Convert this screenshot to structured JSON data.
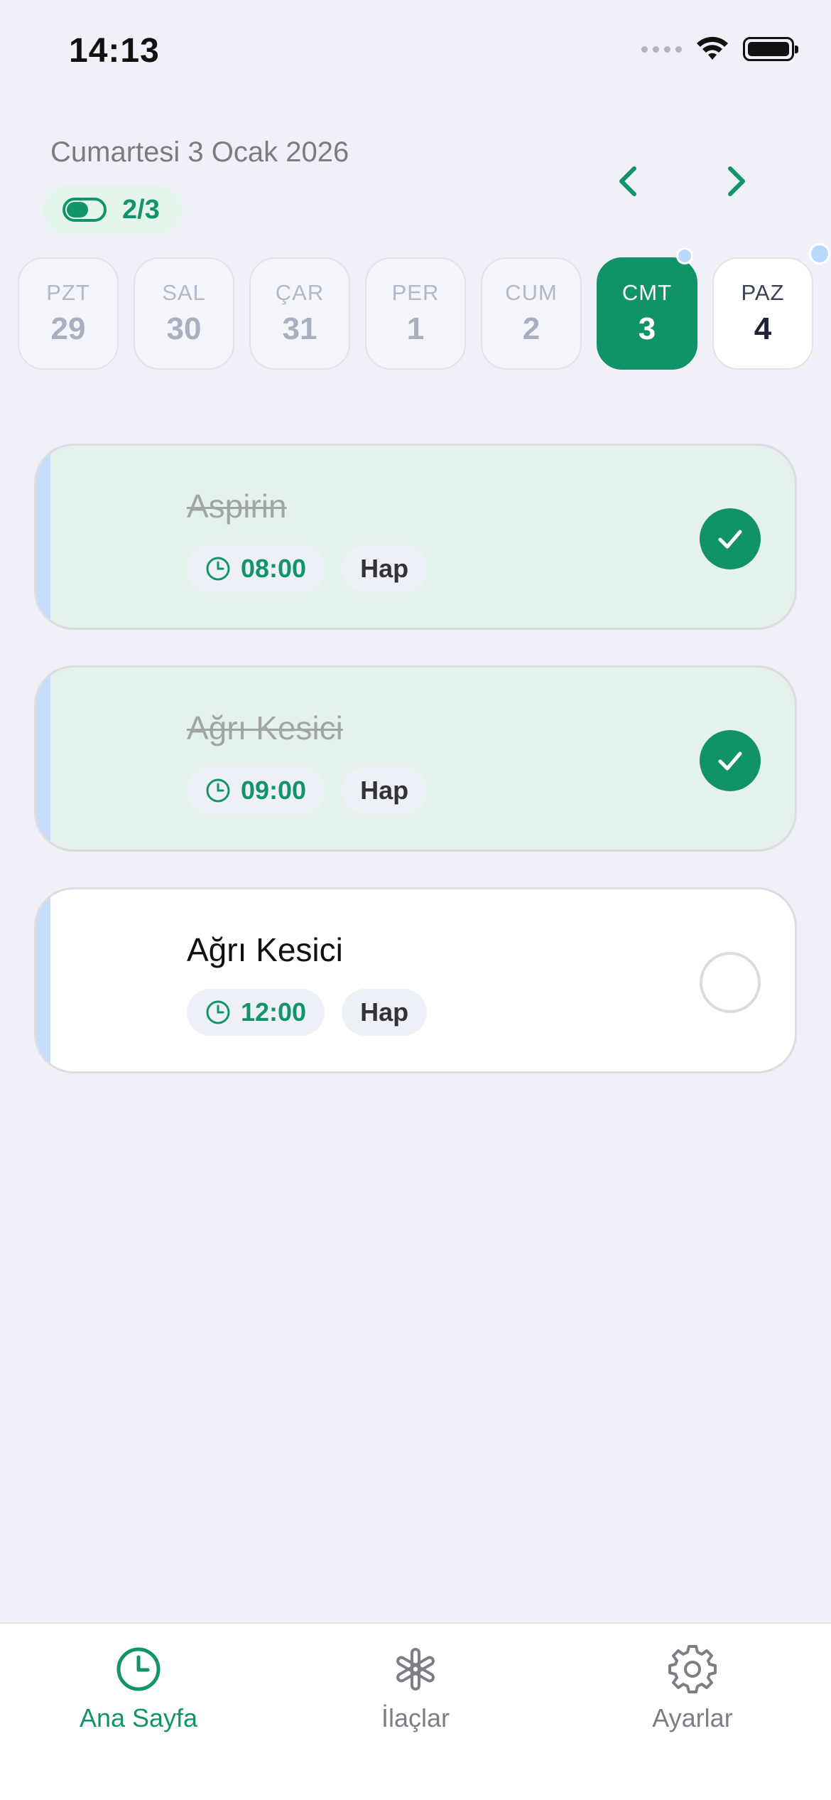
{
  "status_bar": {
    "time": "14:13"
  },
  "header": {
    "date": "Cumartesi 3 Ocak 2026",
    "progress": "2/3"
  },
  "week": [
    {
      "name": "PZT",
      "num": "29",
      "state": "past"
    },
    {
      "name": "SAL",
      "num": "30",
      "state": "past"
    },
    {
      "name": "ÇAR",
      "num": "31",
      "state": "past"
    },
    {
      "name": "PER",
      "num": "1",
      "state": "past"
    },
    {
      "name": "CUM",
      "num": "2",
      "state": "past"
    },
    {
      "name": "CMT",
      "num": "3",
      "state": "selected"
    },
    {
      "name": "PAZ",
      "num": "4",
      "state": "future"
    }
  ],
  "doses": [
    {
      "name": "Aspirin",
      "time": "08:00",
      "type": "Hap",
      "taken": true
    },
    {
      "name": "Ağrı Kesici",
      "time": "09:00",
      "type": "Hap",
      "taken": true
    },
    {
      "name": "Ağrı Kesici",
      "time": "12:00",
      "type": "Hap",
      "taken": false
    }
  ],
  "tabs": [
    {
      "label": "Ana Sayfa",
      "icon": "clock-icon",
      "active": true
    },
    {
      "label": "İlaçlar",
      "icon": "asterisk-icon",
      "active": false
    },
    {
      "label": "Ayarlar",
      "icon": "gear-icon",
      "active": false
    }
  ],
  "colors": {
    "accent": "#11936a",
    "background": "#eff0f8",
    "done_card": "#e5f2ec",
    "card_accent": "#c6dcfb"
  }
}
